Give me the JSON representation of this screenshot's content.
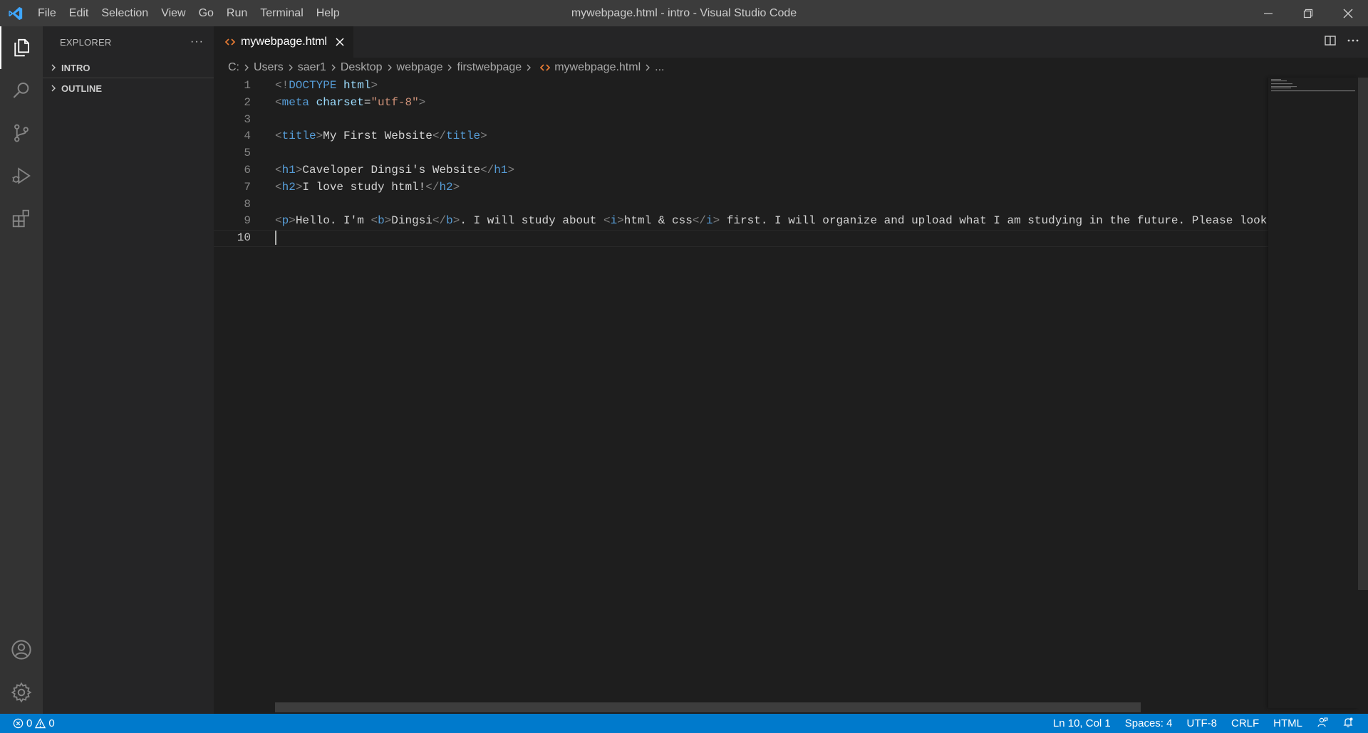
{
  "window": {
    "title": "mywebpage.html - intro - Visual Studio Code",
    "menu": [
      "File",
      "Edit",
      "Selection",
      "View",
      "Go",
      "Run",
      "Terminal",
      "Help"
    ]
  },
  "activity_bar": {
    "top": [
      "files-icon",
      "search-icon",
      "source-control-icon",
      "run-debug-icon",
      "extensions-icon"
    ],
    "bottom": [
      "account-icon",
      "gear-icon"
    ]
  },
  "sidebar": {
    "title": "EXPLORER",
    "more": "···",
    "sections": [
      "INTRO",
      "OUTLINE"
    ]
  },
  "tab": {
    "label": "mywebpage.html"
  },
  "breadcrumb": {
    "items": [
      "C:",
      "Users",
      "saer1",
      "Desktop",
      "webpage",
      "firstwebpage",
      "mywebpage.html",
      "..."
    ]
  },
  "editor": {
    "line_numbers": [
      "1",
      "2",
      "3",
      "4",
      "5",
      "6",
      "7",
      "8",
      "9",
      "10"
    ],
    "current_line": 10,
    "lines": [
      [
        {
          "c": "br",
          "t": "<!"
        },
        {
          "c": "tag",
          "t": "DOCTYPE"
        },
        {
          "c": "txt",
          "t": " "
        },
        {
          "c": "attr",
          "t": "html"
        },
        {
          "c": "br",
          "t": ">"
        }
      ],
      [
        {
          "c": "br",
          "t": "<"
        },
        {
          "c": "tag",
          "t": "meta"
        },
        {
          "c": "txt",
          "t": " "
        },
        {
          "c": "attr",
          "t": "charset"
        },
        {
          "c": "txt",
          "t": "="
        },
        {
          "c": "str",
          "t": "\"utf-8\""
        },
        {
          "c": "br",
          "t": ">"
        }
      ],
      [],
      [
        {
          "c": "br",
          "t": "<"
        },
        {
          "c": "tag",
          "t": "title"
        },
        {
          "c": "br",
          "t": ">"
        },
        {
          "c": "txt",
          "t": "My First Website"
        },
        {
          "c": "br",
          "t": "</"
        },
        {
          "c": "tag",
          "t": "title"
        },
        {
          "c": "br",
          "t": ">"
        }
      ],
      [],
      [
        {
          "c": "br",
          "t": "<"
        },
        {
          "c": "tag",
          "t": "h1"
        },
        {
          "c": "br",
          "t": ">"
        },
        {
          "c": "txt",
          "t": "Caveloper Dingsi's Website"
        },
        {
          "c": "br",
          "t": "</"
        },
        {
          "c": "tag",
          "t": "h1"
        },
        {
          "c": "br",
          "t": ">"
        }
      ],
      [
        {
          "c": "br",
          "t": "<"
        },
        {
          "c": "tag",
          "t": "h2"
        },
        {
          "c": "br",
          "t": ">"
        },
        {
          "c": "txt",
          "t": "I love study html!"
        },
        {
          "c": "br",
          "t": "</"
        },
        {
          "c": "tag",
          "t": "h2"
        },
        {
          "c": "br",
          "t": ">"
        }
      ],
      [],
      [
        {
          "c": "br",
          "t": "<"
        },
        {
          "c": "tag",
          "t": "p"
        },
        {
          "c": "br",
          "t": ">"
        },
        {
          "c": "txt",
          "t": "Hello. I'm "
        },
        {
          "c": "br",
          "t": "<"
        },
        {
          "c": "tag",
          "t": "b"
        },
        {
          "c": "br",
          "t": ">"
        },
        {
          "c": "txt",
          "t": "Dingsi"
        },
        {
          "c": "br",
          "t": "</"
        },
        {
          "c": "tag",
          "t": "b"
        },
        {
          "c": "br",
          "t": ">"
        },
        {
          "c": "txt",
          "t": ". I will study about "
        },
        {
          "c": "br",
          "t": "<"
        },
        {
          "c": "tag",
          "t": "i"
        },
        {
          "c": "br",
          "t": ">"
        },
        {
          "c": "txt",
          "t": "html & css"
        },
        {
          "c": "br",
          "t": "</"
        },
        {
          "c": "tag",
          "t": "i"
        },
        {
          "c": "br",
          "t": ">"
        },
        {
          "c": "txt",
          "t": " first. I will organize and upload what I am studying in the future. Please look"
        }
      ],
      []
    ]
  },
  "status_bar": {
    "errors": "0",
    "warnings": "0",
    "position": "Ln 10, Col 1",
    "spaces": "Spaces: 4",
    "encoding": "UTF-8",
    "eol": "CRLF",
    "language": "HTML"
  },
  "colors": {
    "accent": "#007acc",
    "titlebar": "#3c3c3c",
    "activity_bar": "#333333",
    "sidebar": "#252526",
    "editor": "#1e1e1e",
    "file_icon": "#e37933"
  }
}
